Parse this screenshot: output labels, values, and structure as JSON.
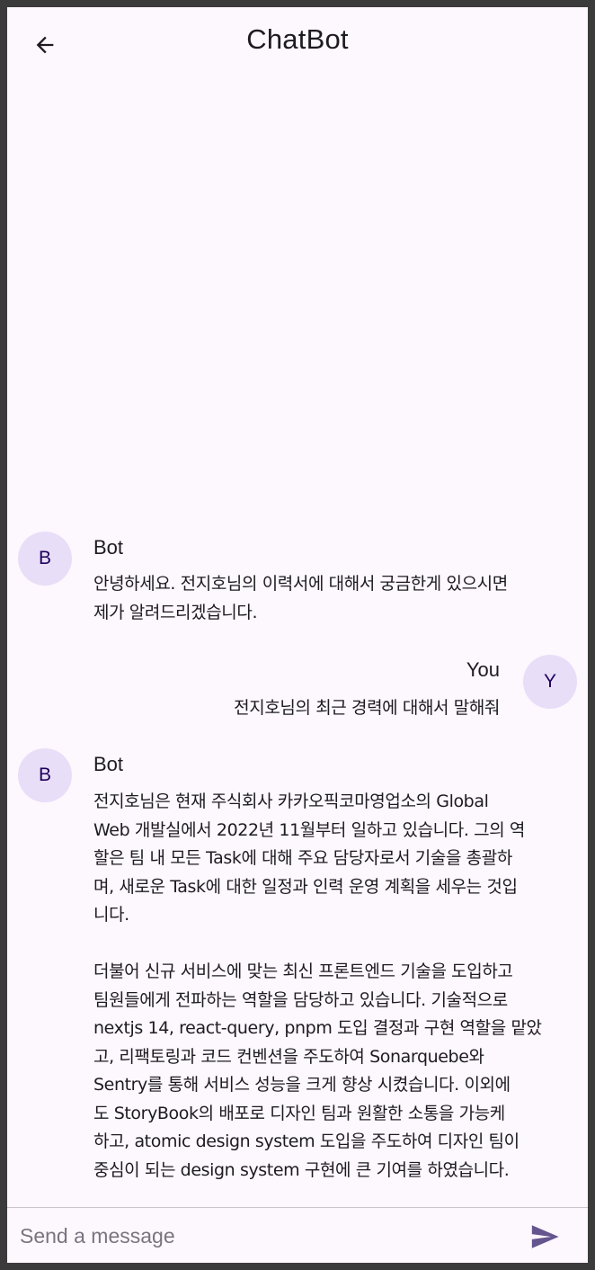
{
  "appbar": {
    "title": "ChatBot",
    "back_icon": "arrow-back-icon"
  },
  "messages": [
    {
      "sender": "Bot",
      "avatar": "B",
      "text": "안녕하세요. 전지호님의 이력서에 대해서 궁금한게 있으시면\n제가 알려드리겠습니다."
    },
    {
      "sender": "You",
      "avatar": "Y",
      "text": "전지호님의 최근 경력에 대해서 말해줘"
    },
    {
      "sender": "Bot",
      "avatar": "B",
      "text": "전지호님은 현재 주식회사 카카오픽코마영업소의 Global\nWeb 개발실에서 2022년 11월부터 일하고 있습니다. 그의 역\n할은 팀 내 모든 Task에 대해 주요 담당자로서 기술을 총괄하\n며, 새로운 Task에 대한 일정과 인력 운영 계획을 세우는 것입\n니다.\n\n더불어 신규 서비스에 맞는 최신 프론트엔드 기술을 도입하고\n팀원들에게 전파하는 역할을 담당하고 있습니다. 기술적으로\nnextjs 14, react-query, pnpm 도입 결정과 구현 역할을 맡았\n고, 리팩토링과 코드 컨벤션을 주도하여 Sonarquebe와\nSentry를 통해 서비스 성능을 크게 향상 시켰습니다. 이외에\n도 StoryBook의 배포로 디자인 팀과 원활한 소통을 가능케\n하고, atomic design system 도입을 주도하여 디자인 팀이\n중심이 되는 design system 구현에 큰 기여를 하였습니다."
    }
  ],
  "composer": {
    "placeholder": "Send a message",
    "value": "",
    "send_icon": "send-icon"
  },
  "colors": {
    "background": "#fdf7fe",
    "avatar_bg": "#e8def8",
    "avatar_text": "#21005d",
    "send_icon": "#65558f",
    "text": "#1d1b20"
  }
}
